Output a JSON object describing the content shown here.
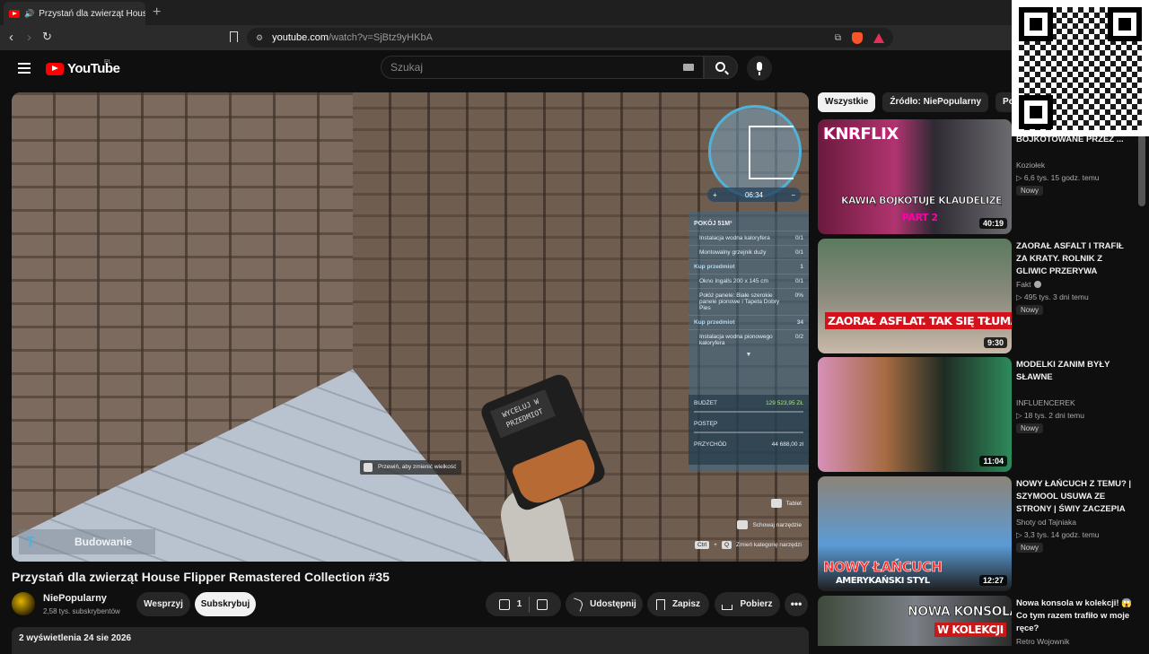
{
  "browser": {
    "tab_title": "Przystań dla zwierząt House Flipper",
    "tab_close": "✕",
    "new_tab": "+",
    "url_host": "youtube.com",
    "url_path": "/watch?v=SjBtz9yHKbA"
  },
  "header": {
    "logo_text": "YouTube",
    "region": "PL",
    "search_placeholder": "Szukaj"
  },
  "game": {
    "minimap_time": "06:34",
    "minimap_plus": "+",
    "minimap_minus": "−",
    "room_title": "POKÓJ 51M²",
    "tasks": [
      {
        "label": "Instalacja wodna kaloryfera",
        "count": "0/1",
        "header": false
      },
      {
        "label": "Montowalny grzejnik duży",
        "count": "0/1",
        "header": false
      },
      {
        "label": "Kup przedmiot",
        "count": "1",
        "header": true
      },
      {
        "label": "Okno Ingalls 200 x 145 cm",
        "count": "0/1",
        "header": false
      },
      {
        "label": "Połóż panele: Białe szerokie panele pionowe i Tapeta Dobry Pies",
        "count": "0%",
        "header": false
      },
      {
        "label": "Kup przedmiot",
        "count": "34",
        "header": true
      },
      {
        "label": "Instalacja wodna pionowego kaloryfera",
        "count": "0/2",
        "header": false
      }
    ],
    "budget_label": "BUDŻET",
    "budget_value": "129 523,95 ZŁ",
    "progress_label": "POSTĘP",
    "income_label": "PRZYCHÓD",
    "income_value": "44 688,00 zł",
    "hint": "Przewiń, aby zmienić wielkość",
    "device_text_line1": "WYCELUJ W",
    "device_text_line2": "PRZEDMIOT",
    "mode_label": "Budowanie",
    "controls": [
      {
        "label": "Tablet"
      },
      {
        "label": "Schowaj narzędzie"
      },
      {
        "label": "Zmień kategorię narzędzi",
        "key1": "Ctrl",
        "key2": "Q"
      }
    ]
  },
  "video": {
    "title": "Przystań dla zwierząt House Flipper Remastered Collection #35",
    "channel": "NiePopularny",
    "subscribers": "2,58 tys. subskrybentów",
    "support_label": "Wesprzyj",
    "subscribe_label": "Subskrybuj",
    "like_count": "1",
    "share_label": "Udostępnij",
    "save_label": "Zapisz",
    "download_label": "Pobierz",
    "more_label": "•••",
    "views_date": "2 wyświetlenia  24 sie 2026"
  },
  "sidebar": {
    "chips": [
      "Wszystkie",
      "Źródło: NiePopularny",
      "Podobne"
    ],
    "items": [
      {
        "title": "ZAMĘCZYNY KLAUDELIZY BOJKOTOWANE PRZEZ ...",
        "channel": "Koziołek",
        "meta": "▷ 6,6 tys.   15 godz. temu",
        "badge": "Nowy",
        "duration": "40:19",
        "thumb_text": "KNRFLIX",
        "thumb_text2": "KAWIĄ BOJKOTUJE KLAUDELIZĘ",
        "thumb_text3": "PART 2"
      },
      {
        "title": "ZAORAŁ ASFALT I TRAFIŁ ZA KRATY. ROLNIK Z GLIWIC PRZERYWA MILCZENIE: TO ...",
        "channel": "Fakt",
        "meta": "▷ 495 tys.   3 dni temu",
        "badge": "Nowy",
        "duration": "9:30",
        "thumb_text": "ZAORAŁ ASFLAT. TAK SIĘ TŁUMACZY!"
      },
      {
        "title": "MODELKI ZANIM BYŁY SŁAWNE",
        "channel": "INFLUENCEREK",
        "meta": "▷ 18 tys.   2 dni temu",
        "badge": "Nowy",
        "duration": "11:04"
      },
      {
        "title": "NOWY ŁAŃCUCH Z TEMU? | SZYMOOL USUWA ZE STRONY | ŚWIY ZACZEPIA ...",
        "channel": "Shoty od Tajniaka",
        "meta": "▷ 3,3 tys.   14 godz. temu",
        "badge": "Nowy",
        "duration": "12:27",
        "thumb_text": "NOWY ŁAŃCUCH",
        "thumb_text2": "AMERYKAŃSKI STYL"
      },
      {
        "title": "Nowa konsola w kolekcji! 😱 Co tym razem trafiło w moje ręce?",
        "channel": "Retro Wojownik",
        "thumb_text": "NOWA KONSOLA",
        "thumb_text2": "W KOLEKCJI"
      }
    ]
  },
  "colors": {
    "background": "#0f0f0f",
    "accent_red": "#ff0000",
    "game_blue": "#4fb3d9"
  }
}
